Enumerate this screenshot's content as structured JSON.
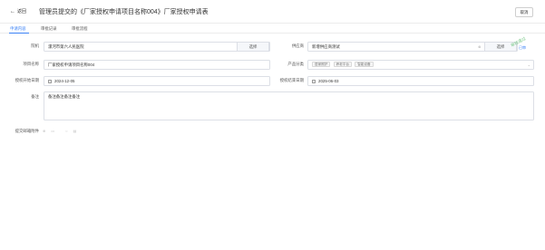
{
  "header": {
    "back_label": "返回",
    "title": "管理员提交的《厂家授权申请项目名称004》厂家授权申请表",
    "cancel_label": "取消"
  },
  "tabs": [
    {
      "label": "申请内容",
      "active": true
    },
    {
      "label": "审批记录",
      "active": false
    },
    {
      "label": "审批流程",
      "active": false
    }
  ],
  "form": {
    "hospital": {
      "label": "院机",
      "value": "漯河市第六人民医院",
      "button": "选择"
    },
    "supplier": {
      "label": "供应商",
      "value": "新增供应商测试",
      "button": "选择"
    },
    "project_name": {
      "label": "项目名称",
      "value": "厂家授权申请项目名称004"
    },
    "product_category": {
      "label": "产品分类",
      "tags": [
        "居家照护",
        "养老平台",
        "智能设备"
      ]
    },
    "auth_start": {
      "label": "授权开始日期",
      "value": "2024-12-05"
    },
    "auth_end": {
      "label": "授权结束日期",
      "value": "2025-06-03"
    },
    "remark": {
      "label": "备注",
      "value": "备注备注备注备注"
    },
    "attachment": {
      "label": "提交邮箱附件"
    }
  },
  "stamp": {
    "text": "审核通过",
    "mark": "已审"
  },
  "colors": {
    "accent": "#3b82f6",
    "stamp": "#7cc98a",
    "border": "#dcdfe6"
  }
}
